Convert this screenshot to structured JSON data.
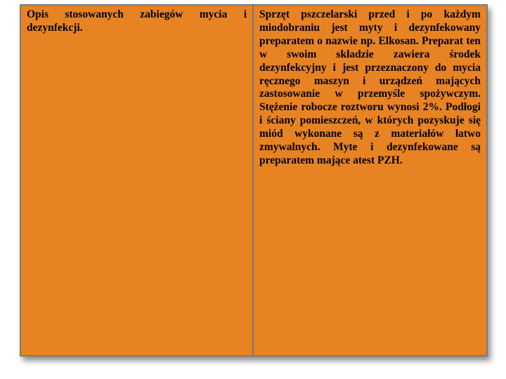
{
  "colors": {
    "card_bg": "#e88324",
    "border": "#7a7a7a"
  },
  "table": {
    "left": "Opis stosowanych zabiegów mycia i dezynfekcji.",
    "right": "Sprzęt pszczelarski przed i po każdym miodobraniu jest myty i dezynfekowany preparatem o nazwie np. Elkosan. Preparat ten w swoim składzie zawiera środek dezynfekcyjny i jest przeznaczony do mycia ręcznego maszyn i urządzeń mających zastosowanie w przemyśle spożywczym. Stężenie robocze roztworu wynosi 2%. Podłogi i ściany pomieszczeń, w których pozyskuje się miód wykonane są z materiałów łatwo zmywalnych. Myte i dezynfekowane są preparatem mające atest PZH."
  }
}
